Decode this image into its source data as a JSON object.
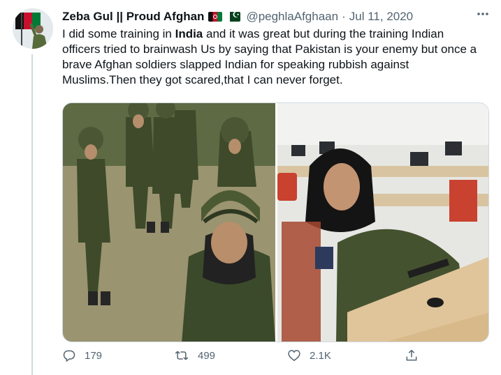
{
  "tweet": {
    "display_name": "Zeba Gul || Proud Afghan",
    "handle": "@peghlaAfghaan",
    "separator": "·",
    "date": "Jul 11, 2020",
    "more_icon": "more-icon",
    "text_before": "I did some  training in ",
    "text_bold": "India",
    "text_after": " and it was great but during  the training Indian officers tried to brainwash Us by saying that Pakistan is your enemy but once a brave Afghan soldiers slapped Indian for speaking rubbish against Muslims.Then they got scared,that I can never forget.",
    "flags": [
      "afghanistan-flag",
      "pakistan-flag"
    ]
  },
  "media": {
    "photos": [
      "soldiers-standing-photo",
      "soldier-at-computer-photo"
    ]
  },
  "actions": {
    "reply_count": "179",
    "retweet_count": "499",
    "like_count": "2.1K",
    "icons": [
      "reply-icon",
      "retweet-icon",
      "like-icon",
      "share-icon"
    ]
  },
  "colors": {
    "text": "#0f1419",
    "secondary": "#536471",
    "border": "#cfd9de",
    "background": "#ffffff"
  }
}
